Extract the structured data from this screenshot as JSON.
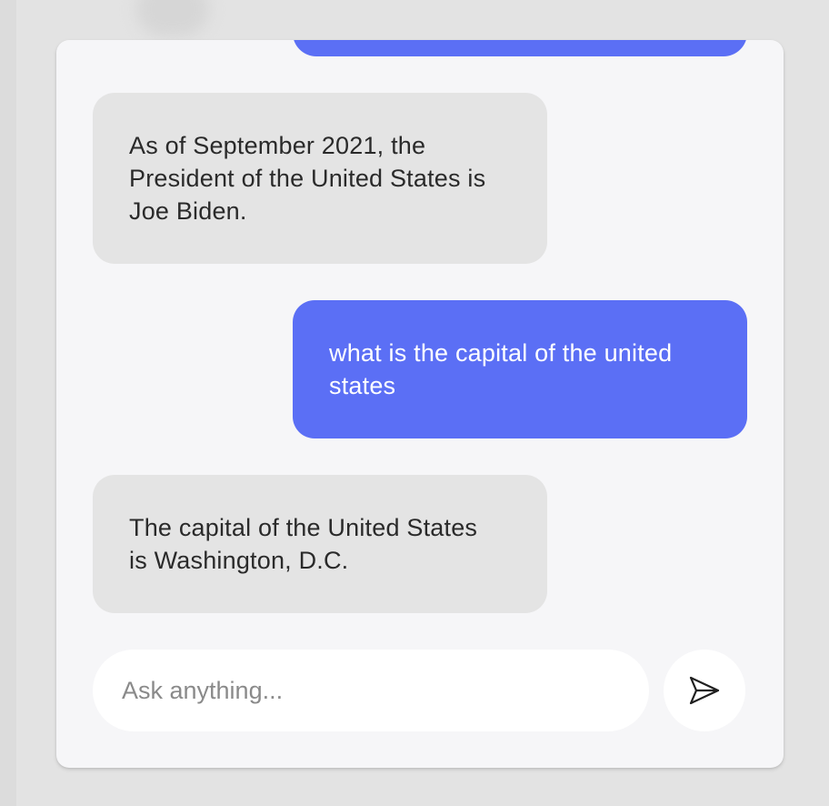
{
  "messages": [
    {
      "role": "assistant",
      "text": "As of September 2021, the President of the United States is Joe Biden."
    },
    {
      "role": "user",
      "text": "what is the capital of the united states"
    },
    {
      "role": "assistant",
      "text": "The capital of the United States is Washington, D.C."
    }
  ],
  "composer": {
    "placeholder": "Ask anything...",
    "value": "",
    "send_icon": "send-icon"
  },
  "colors": {
    "user_bubble": "#5b6ff5",
    "assistant_bubble": "#e4e4e4",
    "panel_background": "#f6f6f8",
    "page_background": "#e3e3e3"
  }
}
